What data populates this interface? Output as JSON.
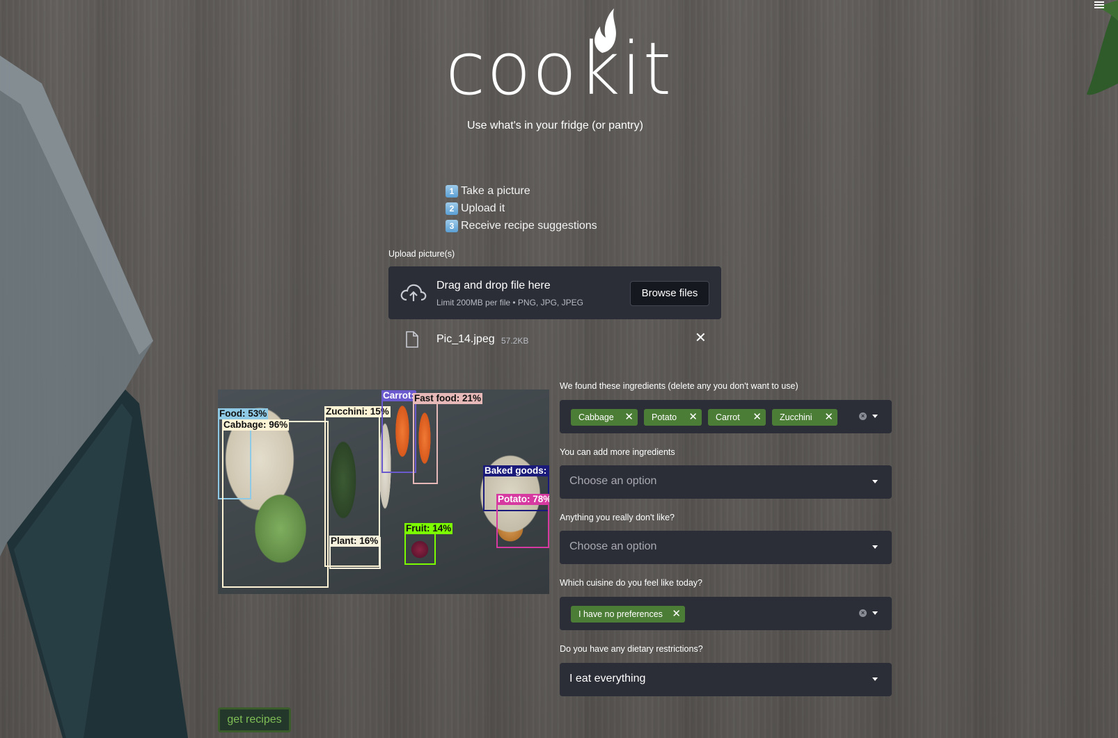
{
  "brand": {
    "logo_text": "cookit",
    "tagline": "Use what's in your fridge (or pantry)"
  },
  "steps": [
    {
      "num": "1",
      "text": "Take a picture"
    },
    {
      "num": "2",
      "text": "Upload it"
    },
    {
      "num": "3",
      "text": "Receive recipe suggestions"
    }
  ],
  "uploader": {
    "label": "Upload picture(s)",
    "title": "Drag and drop file here",
    "hint": "Limit 200MB per file • PNG, JPG, JPEG",
    "browse_label": "Browse files",
    "file": {
      "name": "Pic_14.jpeg",
      "size": "57.2KB"
    }
  },
  "detections": [
    {
      "label": "Food: 53%",
      "color": "#8ecae6"
    },
    {
      "label": "Cabbage: 96%",
      "color": "#fff5d6"
    },
    {
      "label": "Zucchini: 15%",
      "color": "#fff5d6"
    },
    {
      "label": "Carrot:",
      "color": "#6a5acd"
    },
    {
      "label": "Fast food: 21%",
      "color": "#e6b8b8"
    },
    {
      "label": "Baked goods:",
      "color": "#1a1a7a"
    },
    {
      "label": "Potato: 78%",
      "color": "#d63aa0"
    },
    {
      "label": "Fruit: 14%",
      "color": "#7cfc00"
    },
    {
      "label": "Plant: 16%",
      "color": "#f5f0dc"
    }
  ],
  "form": {
    "ingredients": {
      "label": "We found these ingredients (delete any you don't want to use)",
      "tags": [
        "Cabbage",
        "Potato",
        "Carrot",
        "Zucchini"
      ]
    },
    "add_more": {
      "label": "You can add more ingredients",
      "placeholder": "Choose an option"
    },
    "dislikes": {
      "label": "Anything you really don't like?",
      "placeholder": "Choose an option"
    },
    "cuisine": {
      "label": "Which cuisine do you feel like today?",
      "tags": [
        "I have no preferences"
      ]
    },
    "dietary": {
      "label": "Do you have any dietary restrictions?",
      "value": "I eat everything"
    }
  },
  "actions": {
    "get_recipes": "get recipes"
  },
  "colors": {
    "panel": "#2b2d37",
    "tag_green": "#4c7d36",
    "button_text": "#7fbf56"
  }
}
